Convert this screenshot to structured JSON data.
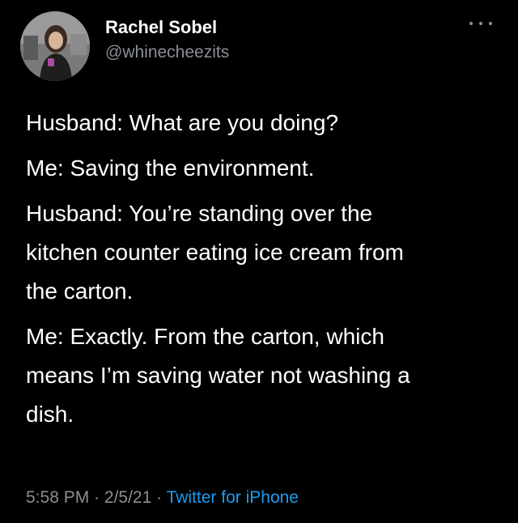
{
  "author": {
    "name": "Rachel Sobel",
    "handle": "@whinecheezits"
  },
  "tweet": {
    "lines": [
      "Husband: What are you doing?",
      "Me: Saving the environment.",
      "Husband: You’re standing over the\nkitchen counter eating ice cream from\nthe carton.",
      "Me: Exactly. From the carton, which\nmeans I’m saving water not washing a\ndish."
    ]
  },
  "meta": {
    "time": "5:58 PM",
    "separator": " · ",
    "date": "2/5/21",
    "source": "Twitter for iPhone"
  },
  "colors": {
    "background": "#000000",
    "text": "#ffffff",
    "secondary": "#8a8f95",
    "link": "#1d9bf0"
  },
  "icons": {
    "more": "more-horizontal-icon"
  }
}
